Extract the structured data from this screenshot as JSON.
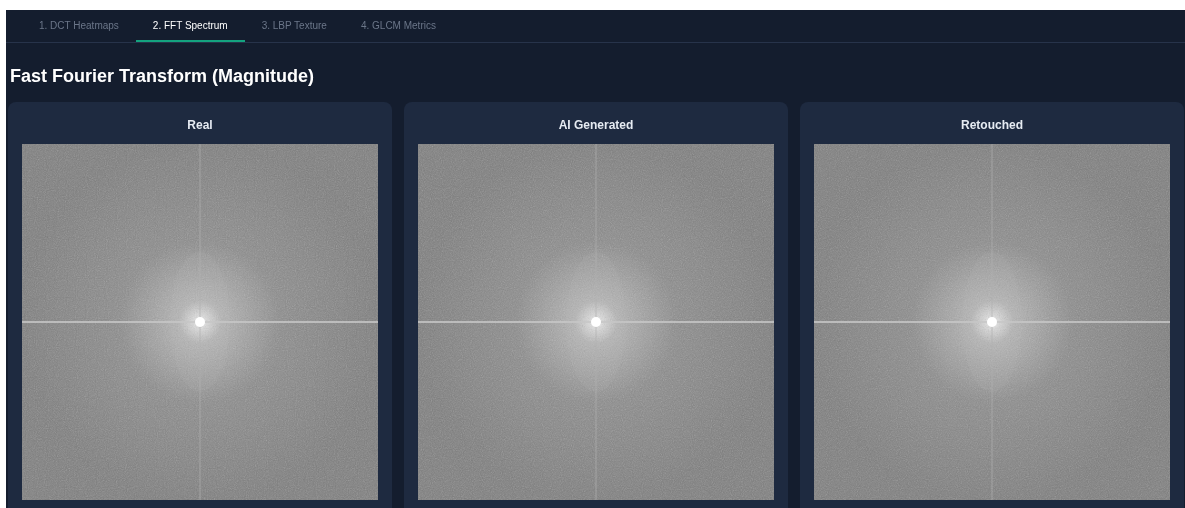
{
  "tabs": [
    {
      "label": "1. DCT Heatmaps",
      "selected": false
    },
    {
      "label": "2. FFT Spectrum",
      "selected": true
    },
    {
      "label": "3. LBP Texture",
      "selected": false
    },
    {
      "label": "4. GLCM Metrics",
      "selected": false
    }
  ],
  "heading": "Fast Fourier Transform (Magnitude)",
  "panels": [
    {
      "title": "Real"
    },
    {
      "title": "AI Generated"
    },
    {
      "title": "Retouched"
    }
  ]
}
